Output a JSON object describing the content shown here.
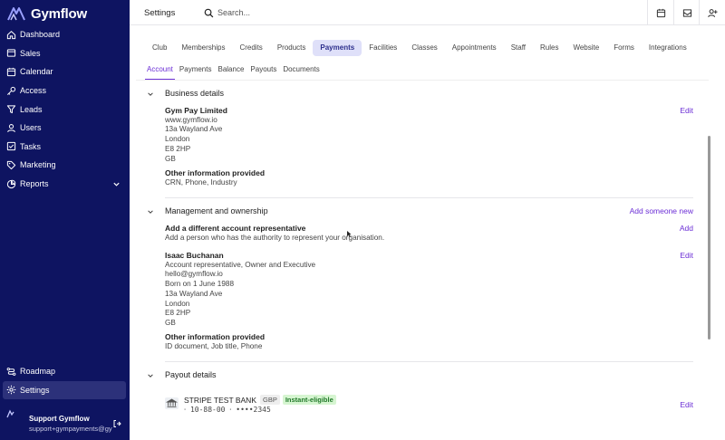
{
  "brand": {
    "name": "Gymflow"
  },
  "sidebar": {
    "items": [
      {
        "label": "Dashboard",
        "icon": "home-icon"
      },
      {
        "label": "Sales",
        "icon": "cart-icon"
      },
      {
        "label": "Calendar",
        "icon": "calendar-icon"
      },
      {
        "label": "Access",
        "icon": "key-icon"
      },
      {
        "label": "Leads",
        "icon": "filter-icon"
      },
      {
        "label": "Users",
        "icon": "users-icon"
      },
      {
        "label": "Tasks",
        "icon": "tasks-icon"
      },
      {
        "label": "Marketing",
        "icon": "tag-icon"
      },
      {
        "label": "Reports",
        "icon": "pie-chart-icon"
      }
    ],
    "bottom_items": [
      {
        "label": "Roadmap",
        "icon": "roadmap-icon"
      },
      {
        "label": "Settings",
        "icon": "gear-icon"
      }
    ],
    "user": {
      "name": "Support Gymflow",
      "email": "support+gympayments@gymflow.io"
    }
  },
  "header": {
    "title": "Settings",
    "search_placeholder": "Search..."
  },
  "tabs": [
    "Club",
    "Memberships",
    "Credits",
    "Products",
    "Payments",
    "Facilities",
    "Classes",
    "Appointments",
    "Staff",
    "Rules",
    "Website",
    "Forms",
    "Integrations"
  ],
  "active_tab": "Payments",
  "subtabs": [
    "Account",
    "Payments",
    "Balance",
    "Payouts",
    "Documents"
  ],
  "active_subtab": "Account",
  "business": {
    "title": "Business details",
    "edit": "Edit",
    "name": "Gym Pay Limited",
    "lines": [
      "www.gymflow.io",
      "13a Wayland Ave",
      "London",
      "E8 2HP",
      "GB"
    ],
    "other_title": "Other information provided",
    "other_value": "CRN, Phone, Industry"
  },
  "management": {
    "title": "Management and ownership",
    "add_someone": "Add someone new",
    "rep_title": "Add a different account representative",
    "rep_desc": "Add a person who has the authority to represent your organisation.",
    "add": "Add",
    "person_name": "Isaac Buchanan",
    "edit": "Edit",
    "person_lines": [
      "Account representative, Owner and Executive",
      "hello@gymflow.io",
      "Born on 1 June 1988",
      "13a Wayland Ave",
      "London",
      "E8 2HP",
      "GB"
    ],
    "other_title": "Other information provided",
    "other_value": "ID document, Job title, Phone"
  },
  "payout": {
    "title": "Payout details",
    "bank_name": "STRIPE TEST BANK",
    "currency": "GBP",
    "status": "Instant-eligible",
    "account": "⸱ 10-88-00 ⸱ ••••2345",
    "edit": "Edit"
  }
}
